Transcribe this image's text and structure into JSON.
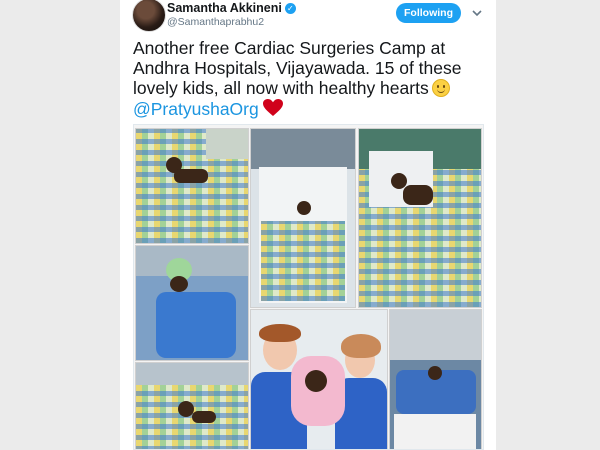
{
  "user": {
    "name": "Samantha Akkineni",
    "handle": "@Samanthaprabhu2",
    "verified_icon": "verified-badge-icon"
  },
  "follow_button": {
    "label": "Following"
  },
  "tweet": {
    "text": "Another free Cardiac Surgeries Camp at Andhra Hospitals, Vijayawada. 15 of these lovely kids, all now with healthy hearts",
    "mention": "@PratyushaOrg",
    "emojis": [
      "smiling-face-icon",
      "red-heart-icon"
    ]
  },
  "colors": {
    "accent": "#1da1f2",
    "mention": "#1b95e0",
    "heart": "#d0021b"
  }
}
